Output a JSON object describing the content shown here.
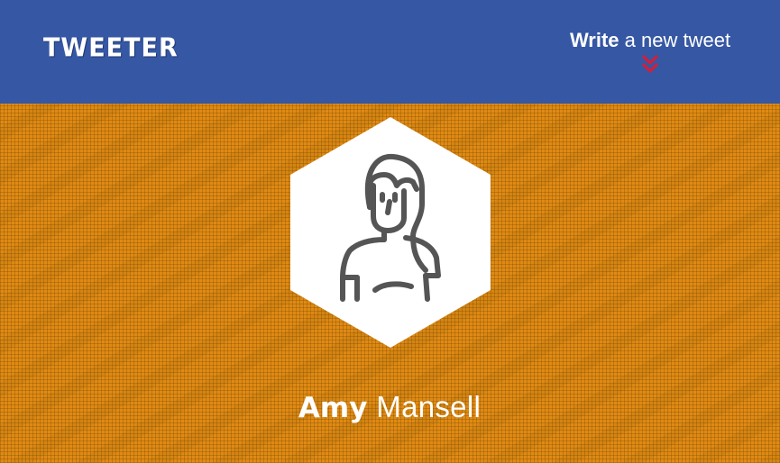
{
  "header": {
    "logo_text": "TWEETER",
    "write_action_strong": "Write",
    "write_action_rest": " a new tweet",
    "chevron_icon": "double-chevron-down-icon"
  },
  "profile": {
    "avatar_icon": "woman-avatar-icon",
    "first_name": "Amy",
    "last_name": "Mansell"
  },
  "colors": {
    "header_bg": "#3657a3",
    "page_bg": "#e08a14",
    "accent_chevron": "#d0203a",
    "text": "#ffffff",
    "avatar_stroke": "#555555"
  }
}
